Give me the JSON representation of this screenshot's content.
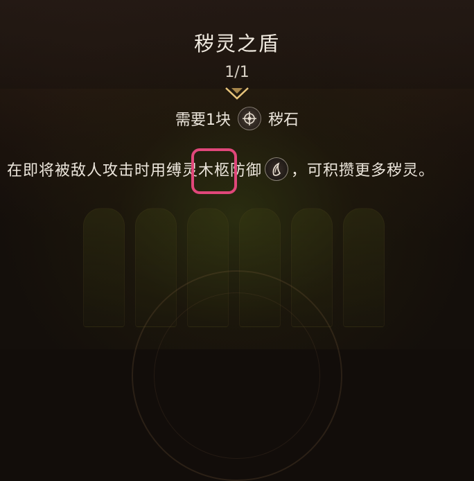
{
  "skill": {
    "title": "秽灵之盾",
    "count": "1/1"
  },
  "requirement": {
    "prefix": "需要1块",
    "icon": "stone-emblem-icon",
    "item": "秽石"
  },
  "description": {
    "part1": "在即将被敌人攻击时用缚灵",
    "highlight": "木柩",
    "part2": "防御",
    "icon": "spirit-orb-icon",
    "part3": "，可积攒更多秽灵。"
  },
  "colors": {
    "highlight_outline": "#e0477a",
    "divider_gold": "#c9a15a",
    "text": "#ece6dc"
  }
}
